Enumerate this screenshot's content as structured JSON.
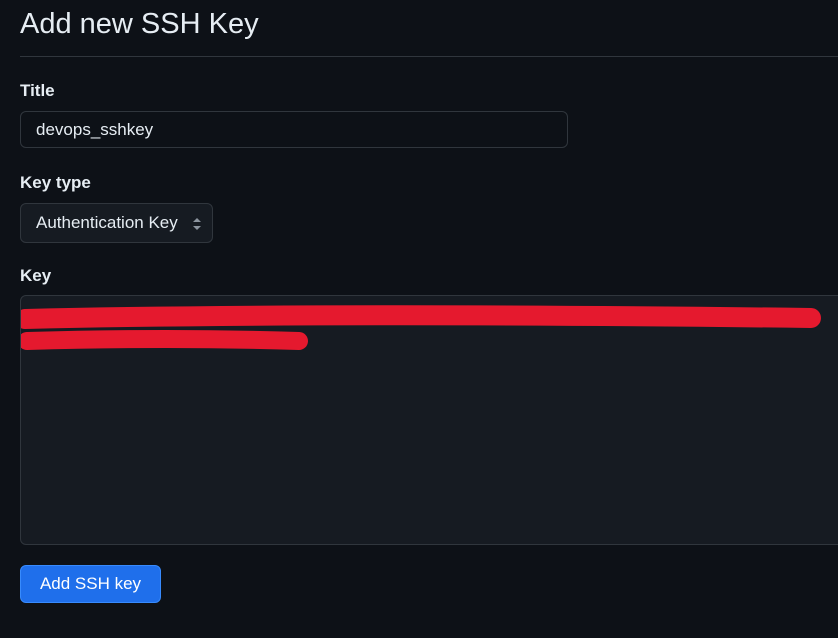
{
  "page": {
    "heading": "Add new SSH Key"
  },
  "form": {
    "title_label": "Title",
    "title_value": "devops_sshkey",
    "key_type_label": "Key type",
    "key_type_selected": "Authentication Key",
    "key_label": "Key",
    "key_value_redacted": true,
    "submit_label": "Add SSH key"
  },
  "colors": {
    "background": "#0d1117",
    "input_background": "#161b22",
    "border": "#30363d",
    "primary_button": "#1f6feb",
    "redaction": "#e5192e"
  },
  "icons": {
    "select_arrows": "chevron-up-down-icon"
  }
}
